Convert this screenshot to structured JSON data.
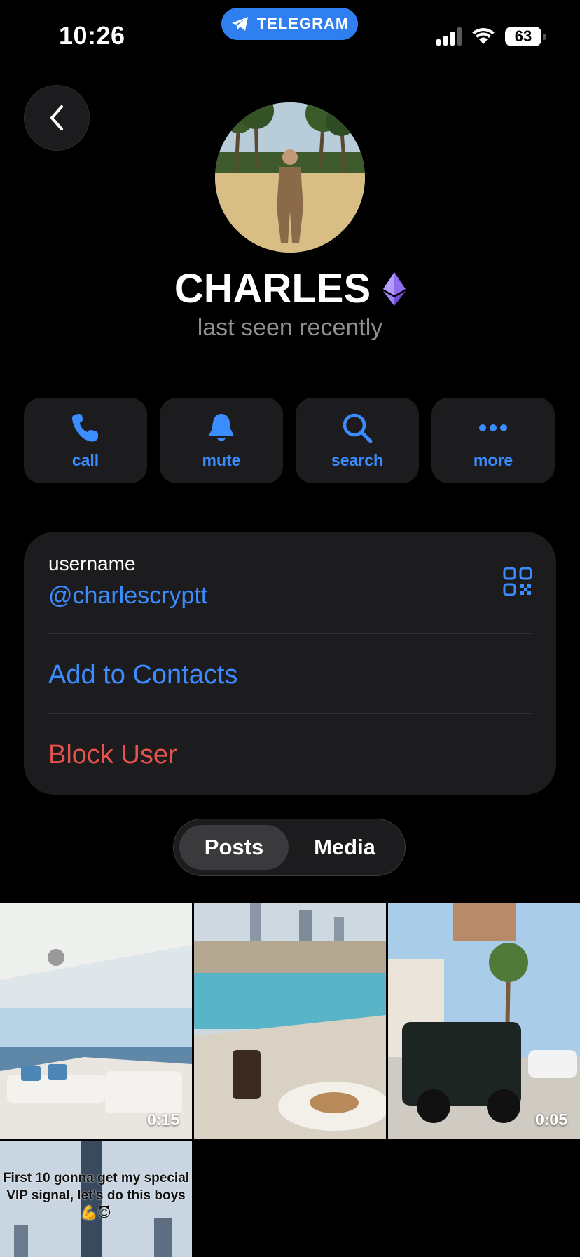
{
  "status_bar": {
    "time": "10:26",
    "app_pill": "TELEGRAM",
    "battery": "63"
  },
  "profile": {
    "name": "CHARLES",
    "status": "last seen recently"
  },
  "actions": [
    {
      "label": "call",
      "icon": "phone-icon"
    },
    {
      "label": "mute",
      "icon": "bell-icon"
    },
    {
      "label": "search",
      "icon": "search-icon"
    },
    {
      "label": "more",
      "icon": "ellipsis-icon"
    }
  ],
  "info": {
    "username_label": "username",
    "username": "@charlescryptt",
    "add_contacts": "Add to Contacts",
    "block_user": "Block User"
  },
  "tabs": {
    "posts": "Posts",
    "media": "Media"
  },
  "media": [
    {
      "duration": "0:15"
    },
    {
      "duration": ""
    },
    {
      "duration": "0:05"
    },
    {
      "caption": "First 10 gonna get my special VIP signal, let's do this boys💪😈"
    }
  ],
  "colors": {
    "accent": "#3b8cff",
    "danger": "#e5534b",
    "card_bg": "#1c1c1e",
    "background": "#000000"
  }
}
